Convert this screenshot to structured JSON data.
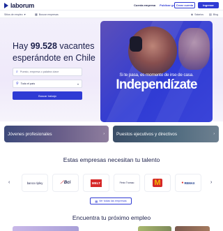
{
  "header": {
    "logo_text": "laborum",
    "links": [
      "Cuenta empresa",
      "Publicar gratis"
    ],
    "create_account": "Crear cuenta",
    "login": "Ingresar"
  },
  "subnav": {
    "home": "Sitios de empleo",
    "search_companies": "Buscar empresas",
    "salary": "Salarios",
    "blog": "Blog"
  },
  "hero": {
    "title_prefix": "Hay ",
    "title_count": "99.528",
    "title_rest_1": " vacantes",
    "title_line2": "esperándote en Chile",
    "search_placeholder": "Puesto, empresa o palabra clave",
    "location_value": "Todo el país",
    "search_button": "Buscar trabajo"
  },
  "banner": {
    "subtitle": "Si te pasa, es momento de irse de casa.",
    "headline": "Independízate"
  },
  "categories": [
    {
      "label": "Jóvenes profesionales"
    },
    {
      "label": "Puestos ejecutivos y directivos"
    }
  ],
  "companies": {
    "title": "Estas empresas necesitan tu talento",
    "brands": [
      "banco ripley",
      "Bci",
      "MELT",
      "Fénix Trumao",
      "M",
      "REMAX"
    ],
    "all_button": "Ver todas las empresas"
  },
  "next": {
    "title": "Encuentra tu próximo empleo"
  },
  "colors": {
    "primary": "#2f3bd4",
    "dark": "#1b1f4a"
  }
}
